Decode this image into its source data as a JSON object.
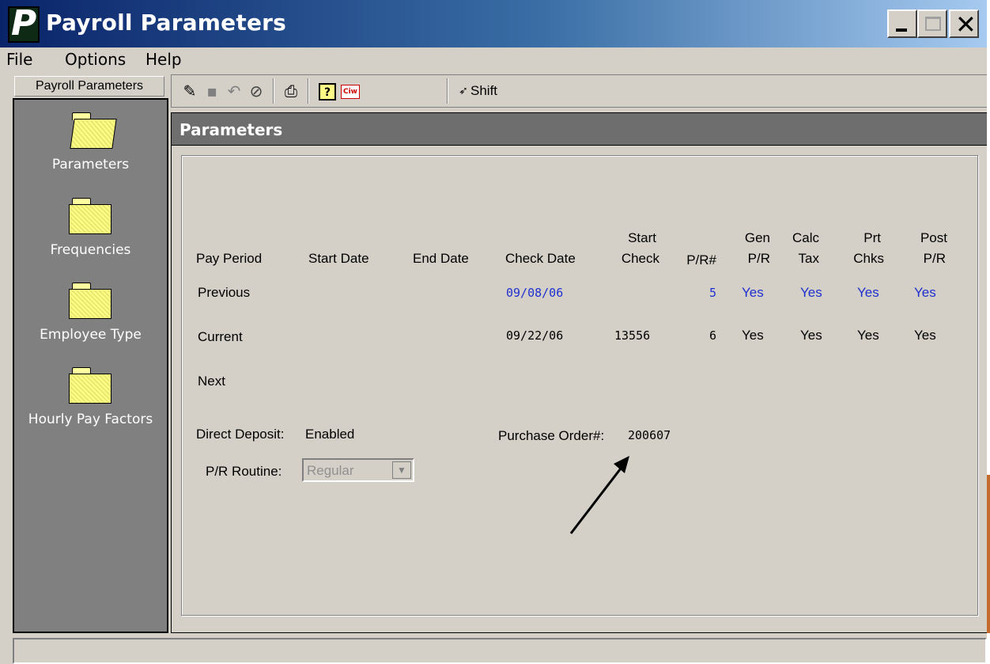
{
  "window": {
    "title": "Payroll Parameters",
    "logo_letter": "P"
  },
  "menu": {
    "file": "File",
    "options": "Options",
    "help": "Help"
  },
  "nav": {
    "header": "Payroll Parameters",
    "items": [
      {
        "label": "Parameters",
        "icon": "open-folder-icon"
      },
      {
        "label": "Frequencies",
        "icon": "folder-icon"
      },
      {
        "label": "Employee Type",
        "icon": "folder-icon"
      },
      {
        "label": "Hourly Pay Factors",
        "icon": "folder-icon"
      }
    ]
  },
  "toolbar": {
    "icons": [
      "pencil-icon",
      "save-icon",
      "undo-icon",
      "cancel-icon",
      "print-icon",
      "help-icon",
      "ciw-logo-icon",
      "shift-icon"
    ],
    "help_glyph": "?",
    "ciw_text": "Ciw",
    "shift_label": "Shift"
  },
  "content": {
    "title": "Parameters",
    "columns": {
      "pay_period": "Pay Period",
      "start_date": "Start Date",
      "end_date": "End Date",
      "check_date": "Check Date",
      "start_check_1": "Start",
      "start_check_2": "Check",
      "pr_num": "P/R#",
      "gen_1": "Gen",
      "gen_2": "P/R",
      "calc_1": "Calc",
      "calc_2": "Tax",
      "prt_1": "Prt",
      "prt_2": "Chks",
      "post_1": "Post",
      "post_2": "P/R"
    },
    "rows": [
      {
        "period": "Previous",
        "start_date": "",
        "end_date": "",
        "check_date": "09/08/06",
        "start_check": "",
        "pr_num": "5",
        "gen": "Yes",
        "calc": "Yes",
        "prt": "Yes",
        "post": "Yes"
      },
      {
        "period": "Current",
        "start_date": "",
        "end_date": "",
        "check_date": "09/22/06",
        "start_check": "13556",
        "pr_num": "6",
        "gen": "Yes",
        "calc": "Yes",
        "prt": "Yes",
        "post": "Yes"
      },
      {
        "period": "Next",
        "start_date": "",
        "end_date": "",
        "check_date": "",
        "start_check": "",
        "pr_num": "",
        "gen": "",
        "calc": "",
        "prt": "",
        "post": ""
      }
    ],
    "direct_deposit_label": "Direct Deposit:",
    "direct_deposit_value": "Enabled",
    "purchase_order_label": "Purchase Order#:",
    "purchase_order_value": "200607",
    "routine_label": "P/R Routine:",
    "routine_value": "Regular"
  },
  "colors": {
    "previous_row": "#1f2fcf",
    "title_gradient_start": "#0a246a",
    "panel_header": "#6e6e6e"
  }
}
